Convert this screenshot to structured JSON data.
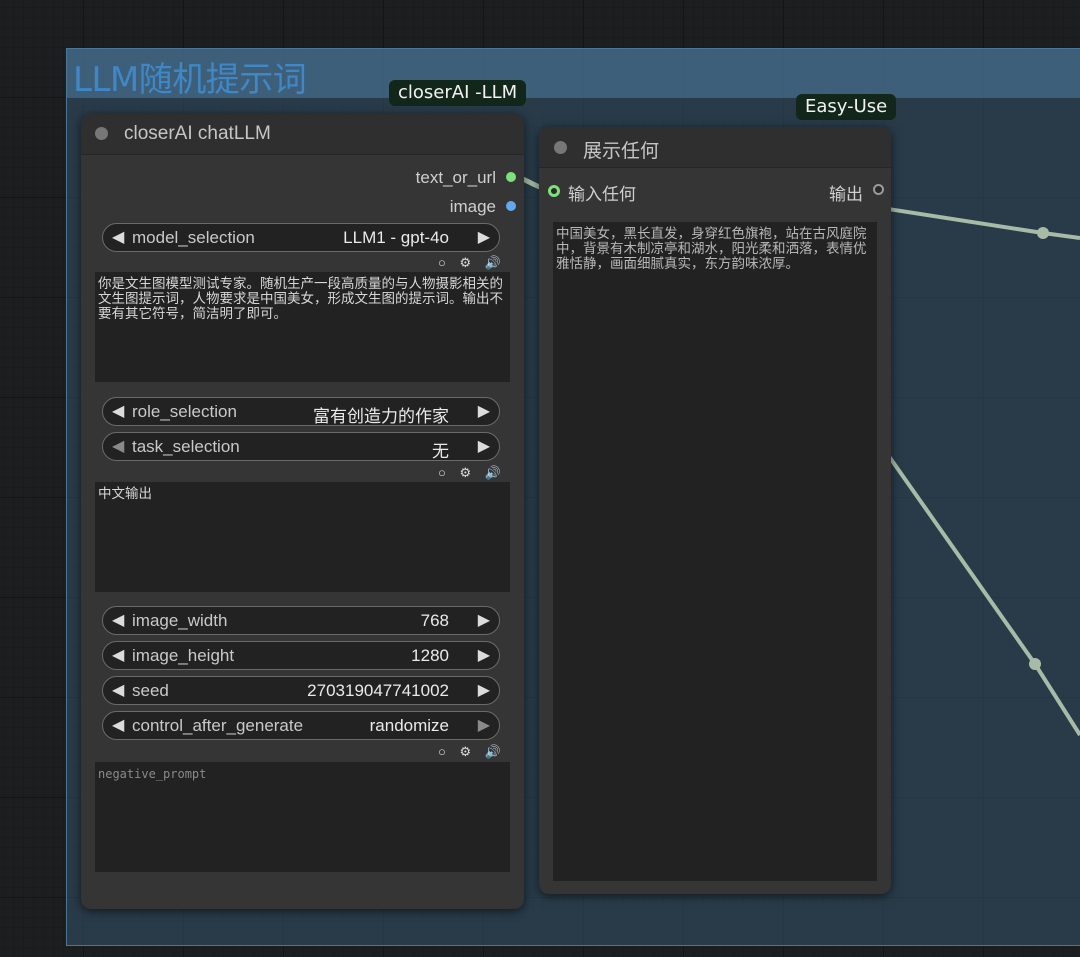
{
  "group": {
    "title": "LLM随机提示词"
  },
  "badges": {
    "llm": "closerAI -LLM",
    "easy": "Easy-Use"
  },
  "llm_node": {
    "title": "closerAI chatLLM",
    "outputs": {
      "text": "text_or_url",
      "image": "image"
    },
    "model_selection": {
      "name": "model_selection",
      "value": "LLM1 - gpt-4o"
    },
    "prompt_text": "你是文生图模型测试专家。随机生产一段高质量的与人物摄影相关的文生图提示词，人物要求是中国美女，形成文生图的提示词。输出不要有其它符号，简洁明了即可。",
    "role_selection": {
      "name": "role_selection",
      "value": "富有创造力的作家"
    },
    "task_selection": {
      "name": "task_selection",
      "value": "无"
    },
    "extra_text": "中文输出",
    "image_width": {
      "name": "image_width",
      "value": "768"
    },
    "image_height": {
      "name": "image_height",
      "value": "1280"
    },
    "seed": {
      "name": "seed",
      "value": "270319047741002"
    },
    "control_after_generate": {
      "name": "control_after_generate",
      "value": "randomize"
    },
    "negative_placeholder": "negative_prompt",
    "tool_icons": "○ ⚙ 🔊"
  },
  "show_node": {
    "title": "展示任何",
    "input_label": "输入任何",
    "output_label": "输出",
    "text": "中国美女，黑长直发，身穿红色旗袍，站在古风庭院中，背景有木制凉亭和湖水，阳光柔和洒落，表情优雅恬静，画面细腻真实，东方韵味浓厚。"
  },
  "colors": {
    "wire": "#a7bba6",
    "text_slot": "#7de07a",
    "image_slot": "#62a8ee",
    "group_title": "#3f87c6"
  },
  "icons": [
    "left-arrow-icon",
    "right-arrow-icon",
    "circle-icon",
    "gear-icon",
    "speaker-icon"
  ]
}
